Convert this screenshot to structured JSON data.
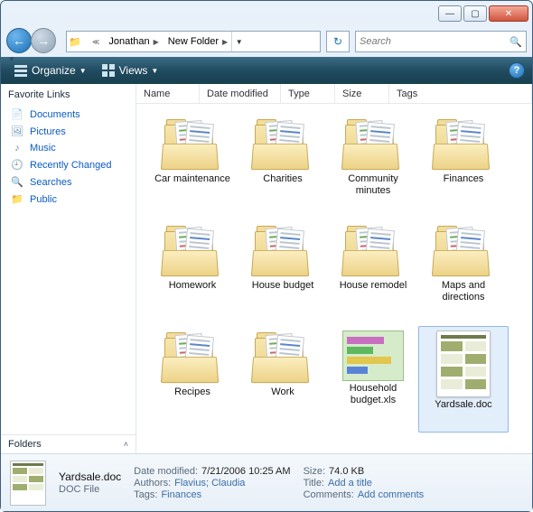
{
  "breadcrumb": {
    "part1": "Jonathan",
    "part2": "New Folder"
  },
  "search": {
    "placeholder": "Search"
  },
  "toolbar": {
    "organize": "Organize",
    "views": "Views"
  },
  "sidebar": {
    "heading": "Favorite Links",
    "items": [
      {
        "label": "Documents",
        "icon": "documents-icon"
      },
      {
        "label": "Pictures",
        "icon": "pictures-icon"
      },
      {
        "label": "Music",
        "icon": "music-icon"
      },
      {
        "label": "Recently Changed",
        "icon": "recent-icon"
      },
      {
        "label": "Searches",
        "icon": "searches-icon"
      },
      {
        "label": "Public",
        "icon": "public-icon"
      }
    ],
    "folders": "Folders"
  },
  "columns": {
    "c0": "Name",
    "c1": "Date modified",
    "c2": "Type",
    "c3": "Size",
    "c4": "Tags"
  },
  "items": [
    {
      "name": "Car maintenance",
      "kind": "folder"
    },
    {
      "name": "Charities",
      "kind": "folder"
    },
    {
      "name": "Community minutes",
      "kind": "folder"
    },
    {
      "name": "Finances",
      "kind": "folder"
    },
    {
      "name": "Homework",
      "kind": "folder"
    },
    {
      "name": "House budget",
      "kind": "folder"
    },
    {
      "name": "House remodel",
      "kind": "folder"
    },
    {
      "name": "Maps and directions",
      "kind": "folder"
    },
    {
      "name": "Recipes",
      "kind": "folder"
    },
    {
      "name": "Work",
      "kind": "folder"
    },
    {
      "name": "Household budget.xls",
      "kind": "xls"
    },
    {
      "name": "Yardsale.doc",
      "kind": "doc",
      "selected": true
    }
  ],
  "details": {
    "filename": "Yardsale.doc",
    "filetype": "DOC File",
    "labels": {
      "date_modified": "Date modified:",
      "authors": "Authors:",
      "tags": "Tags:",
      "size": "Size:",
      "title": "Title:",
      "comments": "Comments:"
    },
    "values": {
      "date_modified": "7/21/2006 10:25 AM",
      "authors": "Flavius; Claudia",
      "tags": "Finances",
      "size": "74.0 KB",
      "title": "Add a title",
      "comments": "Add comments"
    }
  }
}
